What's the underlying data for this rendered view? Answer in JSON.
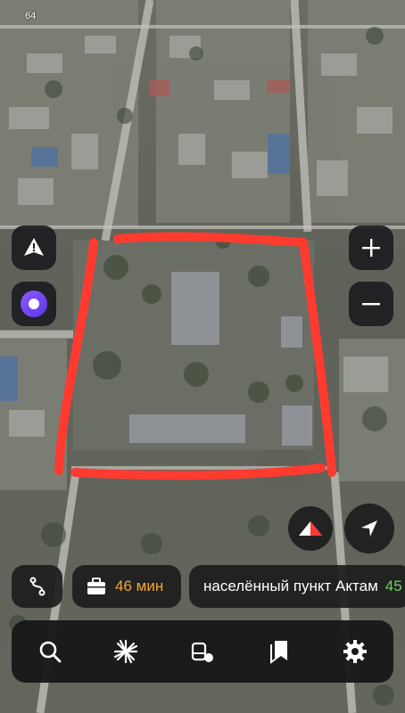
{
  "map": {
    "scale_label": "64",
    "highlight_color": "#ff3b30"
  },
  "controls": {
    "alert_icon": "alert-triangle-icon",
    "assistant_icon": "alice-assistant-icon",
    "zoom_in_icon": "plus-icon",
    "zoom_out_icon": "minus-icon",
    "compass_icon": "compass-icon",
    "locate_icon": "navigation-arrow-icon"
  },
  "chips": {
    "route_icon": "route-icon",
    "time_icon": "briefcase-icon",
    "time_value": "46 мин",
    "time_color": "#f3a532",
    "place_name": "населённый пункт Актам",
    "place_number": "45",
    "place_number_color": "#6cd15a"
  },
  "toolbar": {
    "items": [
      {
        "icon": "search-icon"
      },
      {
        "icon": "discovery-icon"
      },
      {
        "icon": "transport-icon"
      },
      {
        "icon": "bookmarks-icon"
      },
      {
        "icon": "settings-icon"
      }
    ]
  }
}
